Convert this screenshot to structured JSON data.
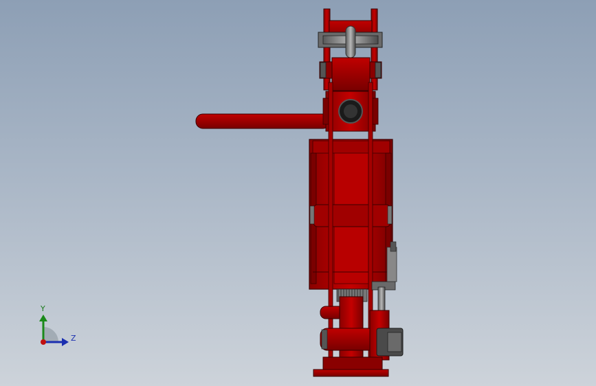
{
  "viewport": {
    "background_top": "#8d9fb5",
    "background_bottom": "#cdd3da"
  },
  "model": {
    "body_color": "#b30000",
    "shade_color": "#7e0000",
    "edge_color": "#3a0000",
    "metal_color": "#8a8a8a",
    "dark_metal_color": "#4a4a4a"
  },
  "triad": {
    "y_label": "Y",
    "z_label": "Z",
    "y_color": "#1a8a1a",
    "z_color": "#1a2fb0",
    "x_color": "#c01010"
  }
}
